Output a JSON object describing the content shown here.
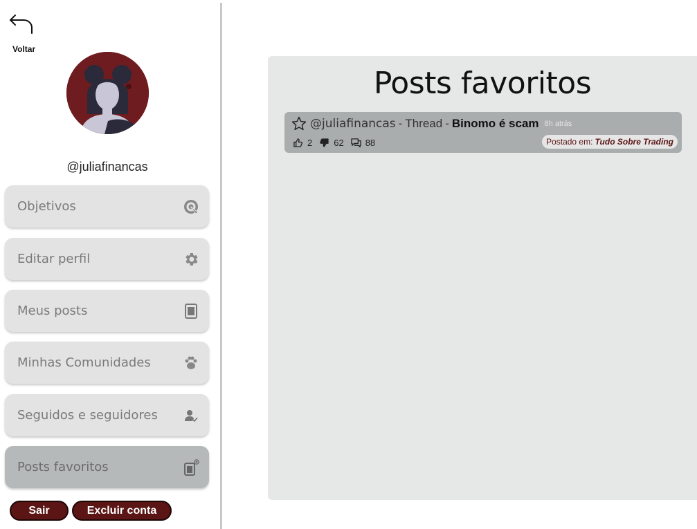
{
  "sidebar": {
    "back_label": "Voltar",
    "username": "@juliafinancas",
    "items": [
      {
        "label": "Objetivos",
        "icon": "target-icon"
      },
      {
        "label": "Editar perfil",
        "icon": "gear-icon"
      },
      {
        "label": "Meus posts",
        "icon": "document-icon"
      },
      {
        "label": "Minhas Comunidades",
        "icon": "paw-icon"
      },
      {
        "label": "Seguidos e seguidores",
        "icon": "user-check-icon"
      },
      {
        "label": "Posts favoritos",
        "icon": "favorite-document-icon",
        "active": true
      }
    ],
    "logout_label": "Sair",
    "delete_label": "Excluir conta"
  },
  "main": {
    "title": "Posts favoritos",
    "posts": [
      {
        "user": "@juliafinancas",
        "separator": "-",
        "type": "Thread",
        "title_separator": "-",
        "title": "Binomo é scam",
        "time": "8h atrás",
        "likes": "2",
        "dislikes": "62",
        "comments": "88",
        "posted_label": "Postado em:",
        "community": "Tudo Sobre Trading"
      }
    ]
  },
  "colors": {
    "accent": "#5a1514",
    "panel": "#e6e7e7",
    "active_item": "#b5b9b9",
    "post_card": "#a9adad"
  }
}
